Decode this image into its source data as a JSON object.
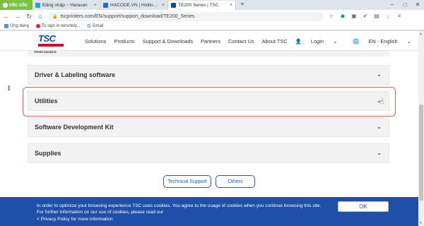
{
  "browser": {
    "brand_label": "cốc cốc",
    "tabs": [
      {
        "title": "Đăng nhập ~ Haravan",
        "fav_color": "#24a0d8"
      },
      {
        "title": "HACODE.VN | Hotline:0942...",
        "fav_color": "#1f6fc9"
      },
      {
        "title": "TE200 Series | TSC",
        "fav_color": "#0f4d9c"
      }
    ],
    "new_tab": "+",
    "url": "tscprinters.com/EN/support/support_download/TE200_Series",
    "bookmarks": [
      "Ứng dụng",
      "To sign in remotely...",
      "Gmail"
    ]
  },
  "site": {
    "logo_text": "TSC",
    "menu": [
      "Solutions",
      "Products",
      "Support & Downloads",
      "Partners",
      "Contact Us",
      "About TSC",
      "Login",
      "EN - English"
    ],
    "brand_color": "#0f4d9c",
    "accent_color": "#c8102e"
  },
  "sections": {
    "cut_off": "Manuals",
    "items": [
      "Driver & Labeling software",
      "Utilities",
      "Software Development Kit",
      "Supplies"
    ],
    "marker": "1",
    "buttons": {
      "technical_support": "Technical Support",
      "others": "Others"
    }
  },
  "cookie": {
    "line1": "In order to optimize your browsing experience TSC uses cookies. You agree to the usage of cookies when you continue browsing this site.",
    "line2": "For further information on our use of cookies, please read our",
    "line3": "< Privacy Policy for more information",
    "ok_label": "OK",
    "banner_color": "#1f4fa8"
  }
}
